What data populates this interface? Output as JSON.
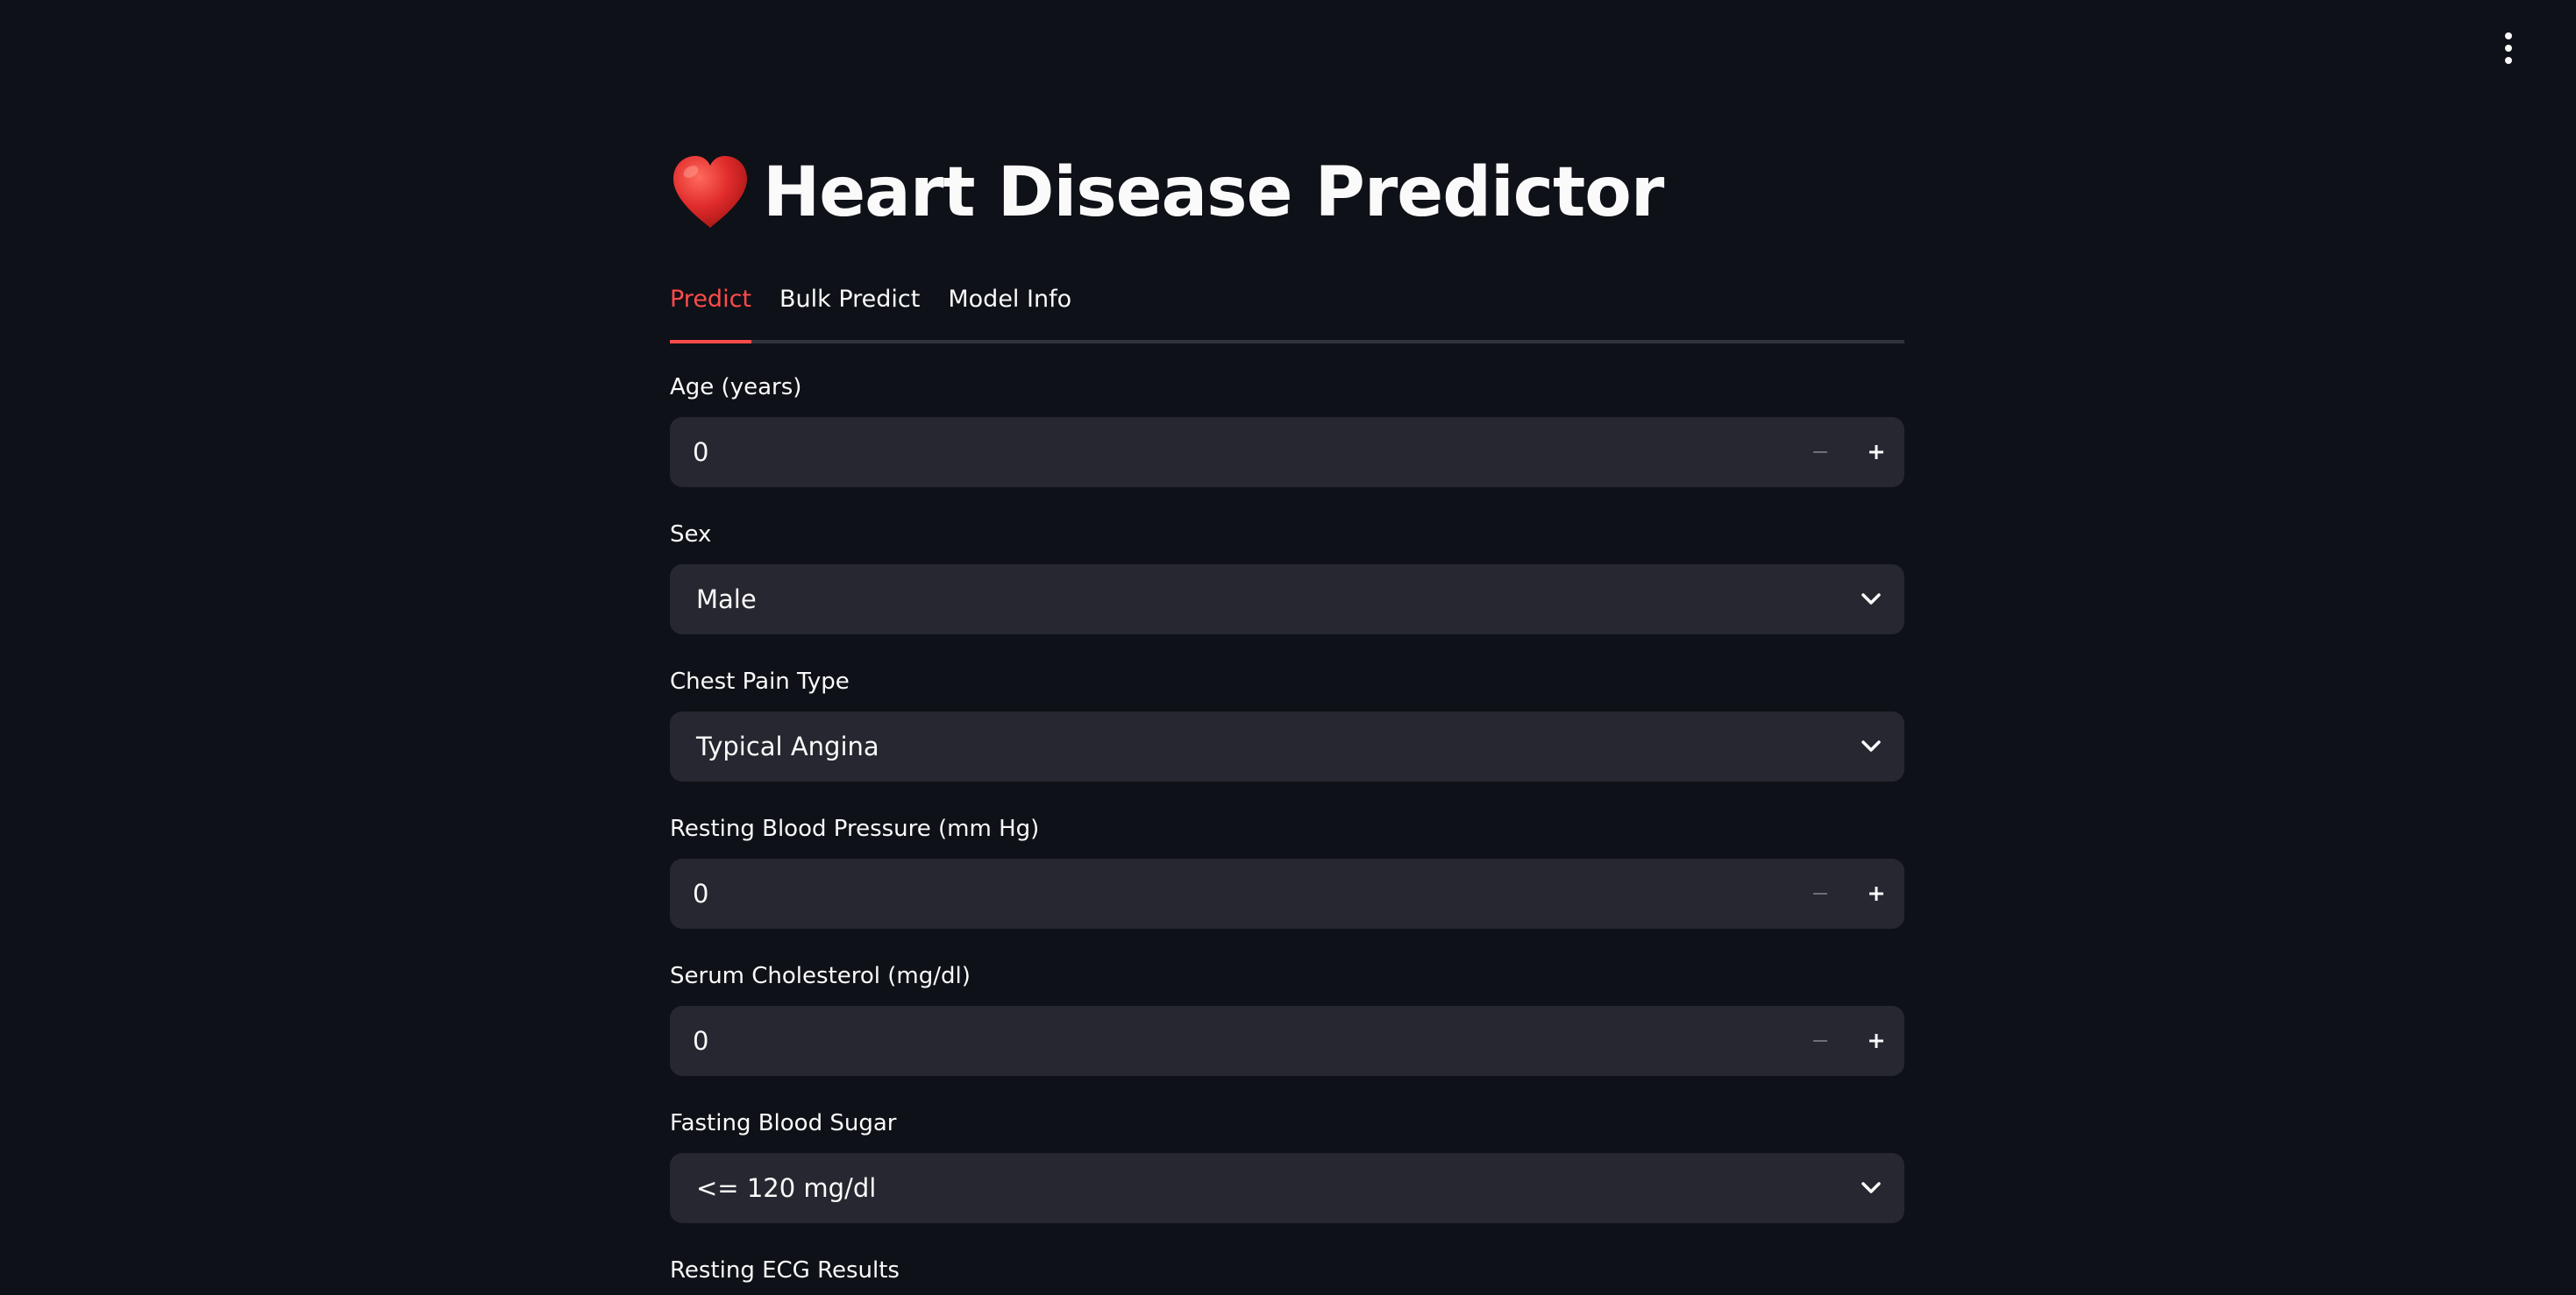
{
  "app": {
    "title": "Heart Disease Predictor",
    "icons": {
      "title_icon": "heart-icon",
      "menu": "vertical-ellipsis-icon",
      "decrement": "minus-icon",
      "increment": "plus-icon",
      "dropdown": "chevron-down-icon"
    },
    "colors": {
      "background": "#0e1117",
      "input_background": "#262730",
      "accent": "#ff4b4b",
      "text": "#fafafa",
      "heart": "#e02b2b"
    }
  },
  "tabs": [
    {
      "label": "Predict",
      "active": true
    },
    {
      "label": "Bulk Predict",
      "active": false
    },
    {
      "label": "Model Info",
      "active": false
    }
  ],
  "form": {
    "age": {
      "label": "Age (years)",
      "value": "0"
    },
    "sex": {
      "label": "Sex",
      "value": "Male"
    },
    "chest_pain": {
      "label": "Chest Pain Type",
      "value": "Typical Angina"
    },
    "resting_bp": {
      "label": "Resting Blood Pressure (mm Hg)",
      "value": "0"
    },
    "cholesterol": {
      "label": "Serum Cholesterol (mg/dl)",
      "value": "0"
    },
    "fasting_bs": {
      "label": "Fasting Blood Sugar",
      "value": "<= 120 mg/dl"
    },
    "resting_ecg": {
      "label": "Resting ECG Results"
    }
  }
}
